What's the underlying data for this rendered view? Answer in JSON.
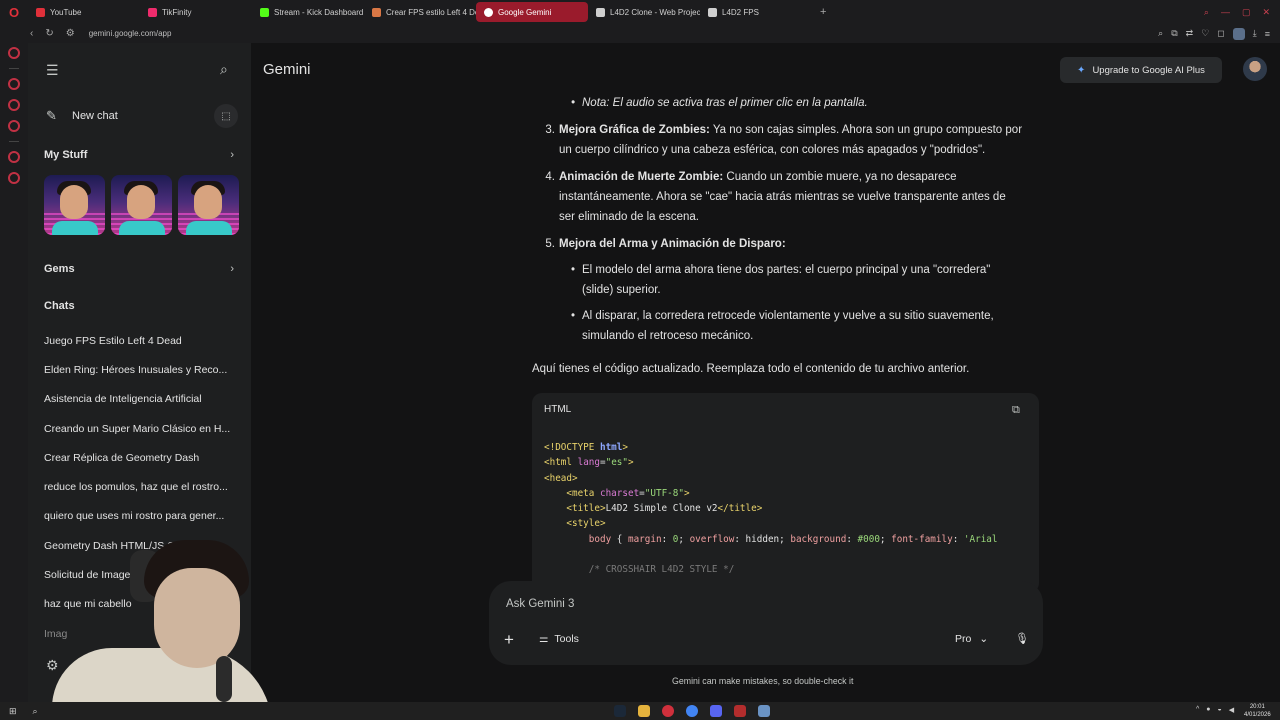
{
  "browser": {
    "tabs": [
      {
        "label": "YouTube",
        "color": "#e0303a",
        "active": false
      },
      {
        "label": "TikFinity",
        "color": "#ee2b6c",
        "active": false
      },
      {
        "label": "Stream - Kick Dashboard",
        "color": "#53fc18",
        "active": false
      },
      {
        "label": "Crear FPS estilo Left 4 De",
        "color": "#d97745",
        "active": false
      },
      {
        "label": "Google Gemini",
        "color": "#ffffff",
        "active": true
      },
      {
        "label": "L4D2 Clone - Web Project",
        "color": "#cfcfcf",
        "active": false
      },
      {
        "label": "L4D2 FPS",
        "color": "#cfcfcf",
        "active": false
      }
    ],
    "url": "gemini.google.com/app"
  },
  "sidebar": {
    "new_chat": "New chat",
    "my_stuff": "My Stuff",
    "gems": "Gems",
    "chats_heading": "Chats",
    "chats": [
      "Juego FPS Estilo Left 4 Dead",
      "Elden Ring: Héroes Inusuales y Reco...",
      "Asistencia de Inteligencia Artificial",
      "Creando un Super Mario Clásico en H...",
      "Crear Réplica de Geometry Dash",
      "reduce los pomulos, haz que el rostro...",
      "quiero que uses mi rostro para gener...",
      "Geometry Dash HTML/JS Clon",
      "Solicitud de Imagen R",
      "haz que mi cabello",
      "Imag"
    ]
  },
  "header": {
    "title": "Gemini",
    "upgrade": "Upgrade to Google AI Plus"
  },
  "response": {
    "note": "Nota: El audio se activa tras el primer clic en la pantalla.",
    "items": [
      {
        "num": "3.",
        "title": "Mejora Gráfica de Zombies:",
        "line1": "Ya no son cajas simples. Ahora son un grupo compuesto por",
        "line2": "un cuerpo cilíndrico y una cabeza esférica, con colores más apagados y \"podridos\"."
      },
      {
        "num": "4.",
        "title": "Animación de Muerte Zombie:",
        "line1": "Cuando un zombie muere, ya no desaparece",
        "line2": "instantáneamente. Ahora se \"cae\" hacia atrás mientras se vuelve transparente antes de",
        "line3": "ser eliminado de la escena."
      },
      {
        "num": "5.",
        "title": "Mejora del Arma y Animación de Disparo:"
      }
    ],
    "sub_bullets": [
      {
        "line1": "El modelo del arma ahora tiene dos partes: el cuerpo principal y una \"corredera\"",
        "line2": "(slide) superior."
      },
      {
        "line1": "Al disparar, la corredera retrocede violentamente y vuelve a su sitio suavemente,",
        "line2": "simulando el retroceso mecánico."
      }
    ],
    "closing": "Aquí tienes el código actualizado. Reemplaza todo el contenido de tu archivo anterior."
  },
  "code": {
    "language": "HTML",
    "line1_a": "<!DOCTYPE ",
    "line1_b": "html",
    "line1_c": ">",
    "line2_a": "<html ",
    "line2_b": "lang",
    "line2_c": "=",
    "line2_d": "\"es\"",
    "line2_e": ">",
    "line3": "<head>",
    "line4_a": "<meta ",
    "line4_b": "charset",
    "line4_c": "=",
    "line4_d": "\"UTF-8\"",
    "line4_e": ">",
    "line5_a": "<title>",
    "line5_b": "L4D2 Simple Clone v2",
    "line5_c": "</title>",
    "line6": "<style>",
    "line7_a": "body",
    " line7_b": "",
    "line7_b": " { ",
    "line7_c": "margin",
    "line7_d": ": ",
    "line7_e": "0",
    "line7_f": "; ",
    "line7_g": "overflow",
    "line7_h": ": hidden; ",
    "line7_i": "background",
    "line7_j": ": ",
    "line7_k": "#000",
    "line7_l": "; ",
    "line7_m": "font-family",
    "line7_n": ": ",
    "line7_o": "'Arial",
    "line8": "/* CROSSHAIR L4D2 STYLE */"
  },
  "input": {
    "placeholder": "Ask Gemini 3",
    "tools": "Tools",
    "model": "Pro"
  },
  "disclaimer": "Gemini can make mistakes, so double-check it",
  "taskbar": {
    "time": "20:01",
    "date": "4/01/2026"
  }
}
